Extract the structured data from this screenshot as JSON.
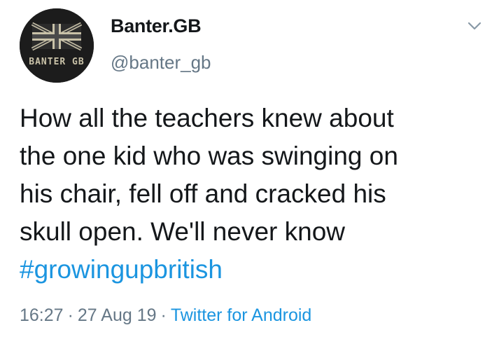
{
  "author": {
    "display_name": "Banter.GB",
    "handle": "@banter_gb",
    "avatar_text": "BANTER GB",
    "avatar_icon": "union-jack-logo"
  },
  "menu": {
    "icon": "chevron-down-icon"
  },
  "tweet": {
    "lines": [
      "How all the teachers knew about",
      "the one kid who was swinging on",
      "his chair, fell off and cracked his",
      "skull open. We'll never know"
    ],
    "hashtag": "#growingupbritish"
  },
  "meta": {
    "time": "16:27",
    "separator": "·",
    "date": "27 Aug 19",
    "source": "Twitter for Android"
  },
  "colors": {
    "text": "#14171a",
    "secondary": "#657786",
    "link": "#1b95e0",
    "avatar_bg": "#1c1c1c"
  }
}
